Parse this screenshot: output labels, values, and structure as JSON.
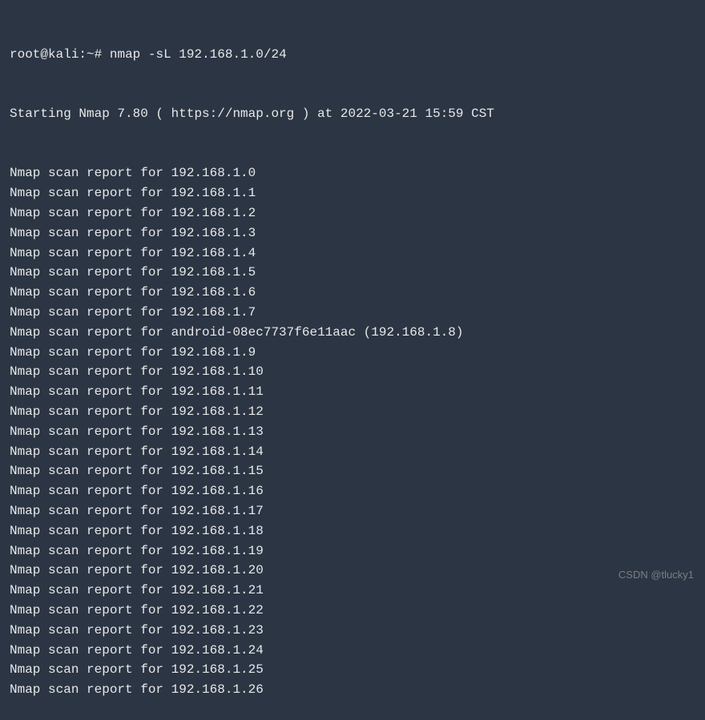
{
  "prompt": {
    "user_host": "root@kali",
    "path": "~",
    "hash": "#",
    "command": "nmap -sL 192.168.1.0/24"
  },
  "starting_line": "Starting Nmap 7.80 ( https://nmap.org ) at 2022-03-21 15:59 CST",
  "scan_prefix": "Nmap scan report for ",
  "scan_results": [
    "192.168.1.0",
    "192.168.1.1",
    "192.168.1.2",
    "192.168.1.3",
    "192.168.1.4",
    "192.168.1.5",
    "192.168.1.6",
    "192.168.1.7",
    "android-08ec7737f6e11aac (192.168.1.8)",
    "192.168.1.9",
    "192.168.1.10",
    "192.168.1.11",
    "192.168.1.12",
    "192.168.1.13",
    "192.168.1.14",
    "192.168.1.15",
    "192.168.1.16",
    "192.168.1.17",
    "192.168.1.18",
    "192.168.1.19",
    "192.168.1.20",
    "192.168.1.21",
    "192.168.1.22",
    "192.168.1.23",
    "192.168.1.24",
    "192.168.1.25",
    "192.168.1.26"
  ],
  "watermark": "CSDN @tlucky1"
}
